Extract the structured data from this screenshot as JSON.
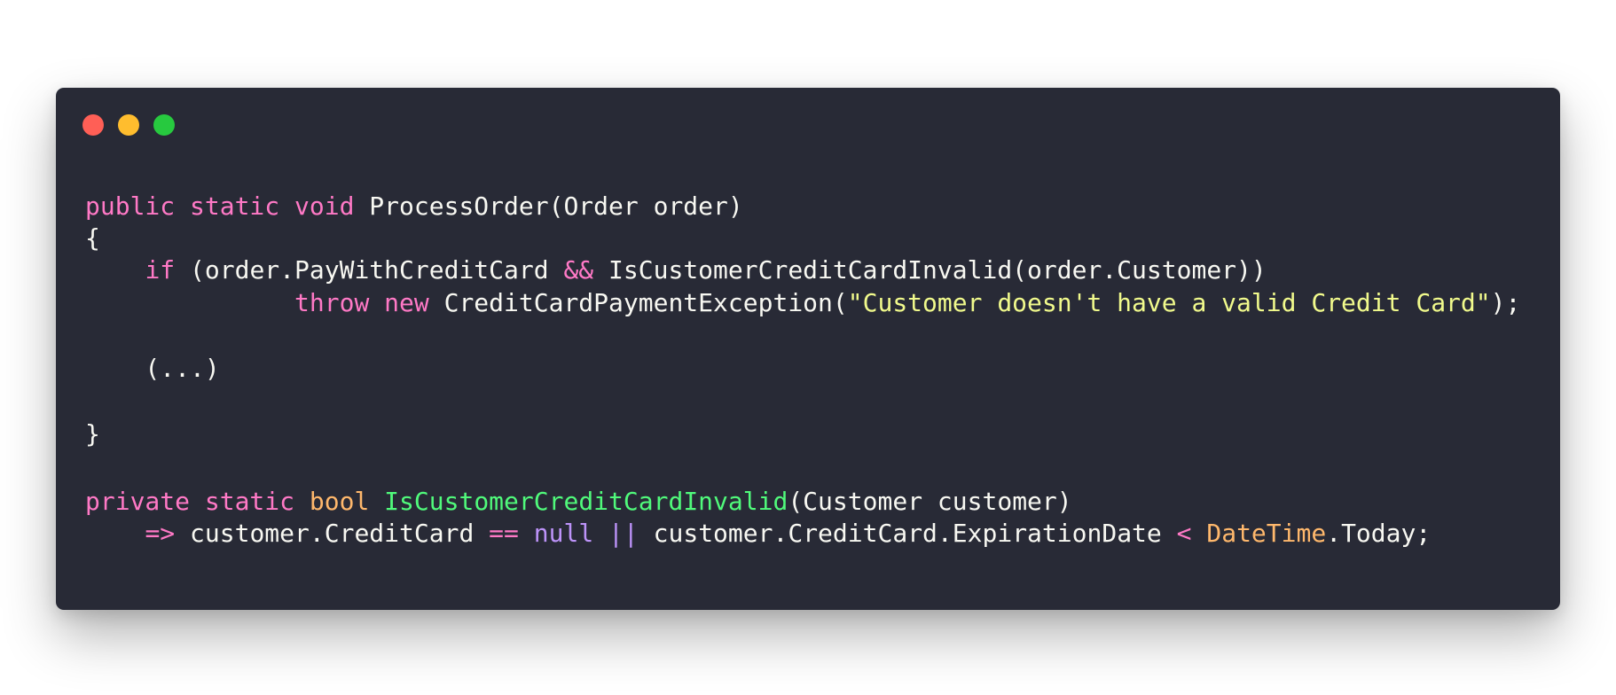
{
  "window": {
    "controls": [
      {
        "name": "close",
        "color": "#ff5f56"
      },
      {
        "name": "minimize",
        "color": "#ffbd2e"
      },
      {
        "name": "maximize",
        "color": "#27c93f"
      }
    ]
  },
  "colors": {
    "background": "#282a36",
    "plain": "#f8f8f2",
    "keyword": "#ff79c6",
    "type": "#ffb86c",
    "method": "#50fa7b",
    "string": "#f1fa8c",
    "constant": "#bd93f9"
  },
  "code": {
    "lines": [
      [
        {
          "t": "public static void",
          "k": "keyword"
        },
        {
          "t": " ProcessOrder(Order order)",
          "k": "plain"
        }
      ],
      [
        {
          "t": "{",
          "k": "plain"
        }
      ],
      [
        {
          "t": "    ",
          "k": "plain"
        },
        {
          "t": "if",
          "k": "keyword"
        },
        {
          "t": " (order.PayWithCreditCard ",
          "k": "plain"
        },
        {
          "t": "&&",
          "k": "keyword"
        },
        {
          "t": " IsCustomerCreditCardInvalid(order.Customer))",
          "k": "plain"
        }
      ],
      [
        {
          "t": "              ",
          "k": "plain"
        },
        {
          "t": "throw new",
          "k": "keyword"
        },
        {
          "t": " CreditCardPaymentException(",
          "k": "plain"
        },
        {
          "t": "\"Customer doesn't have a valid Credit Card\"",
          "k": "string"
        },
        {
          "t": ");",
          "k": "plain"
        }
      ],
      [
        {
          "t": "    (...)",
          "k": "plain"
        }
      ],
      [
        {
          "t": "}",
          "k": "plain"
        }
      ],
      [
        {
          "t": "private static",
          "k": "keyword"
        },
        {
          "t": " ",
          "k": "plain"
        },
        {
          "t": "bool",
          "k": "type"
        },
        {
          "t": " ",
          "k": "plain"
        },
        {
          "t": "IsCustomerCreditCardInvalid",
          "k": "method"
        },
        {
          "t": "(Customer customer)",
          "k": "plain"
        }
      ],
      [
        {
          "t": "    ",
          "k": "plain"
        },
        {
          "t": "=>",
          "k": "keyword"
        },
        {
          "t": " customer.CreditCard ",
          "k": "plain"
        },
        {
          "t": "==",
          "k": "keyword"
        },
        {
          "t": " ",
          "k": "plain"
        },
        {
          "t": "null",
          "k": "constant"
        },
        {
          "t": " ",
          "k": "plain"
        },
        {
          "t": "||",
          "k": "constant"
        },
        {
          "t": " customer.CreditCard.ExpirationDate ",
          "k": "plain"
        },
        {
          "t": "<",
          "k": "keyword"
        },
        {
          "t": " ",
          "k": "plain"
        },
        {
          "t": "DateTime",
          "k": "type"
        },
        {
          "t": ".Today;",
          "k": "plain"
        }
      ]
    ]
  }
}
